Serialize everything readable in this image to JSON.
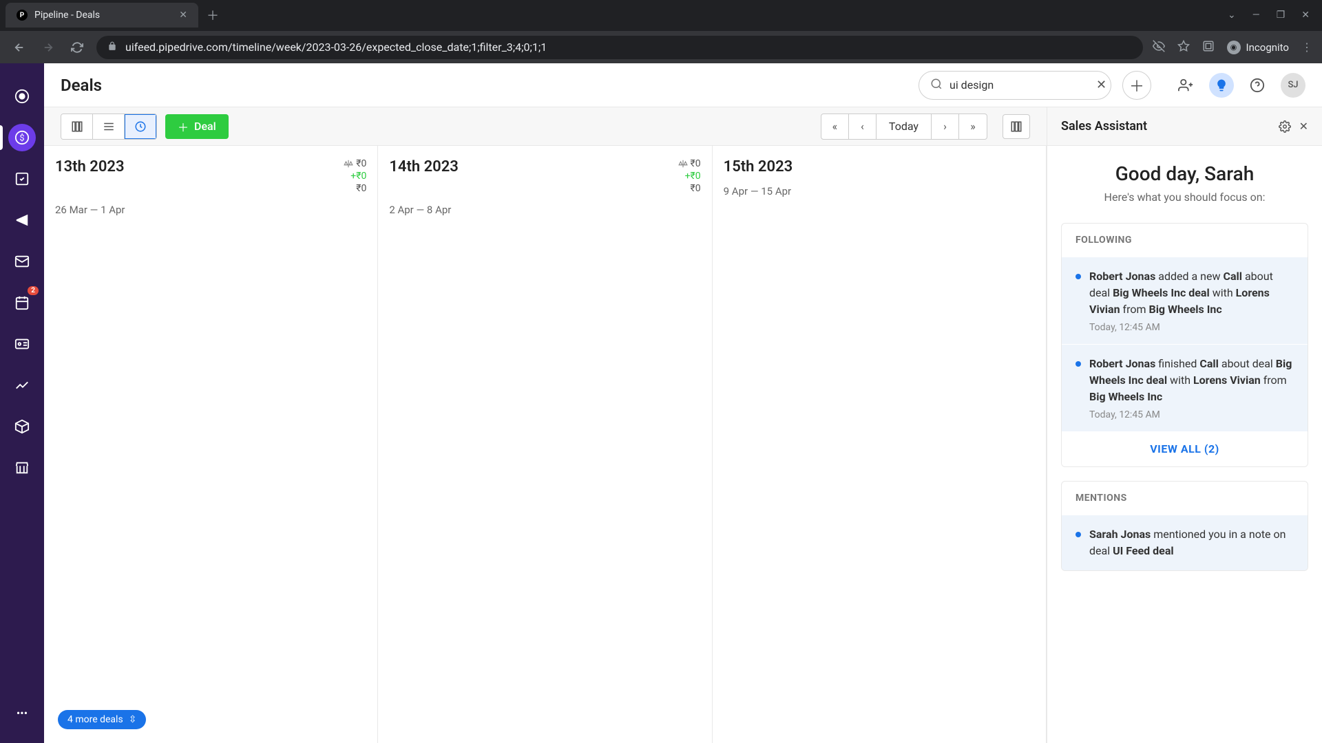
{
  "browser": {
    "tab_title": "Pipeline - Deals",
    "url": "uifeed.pipedrive.com/timeline/week/2023-03-26/expected_close_date;1;filter_3;4;0;1;1",
    "incognito_label": "Incognito"
  },
  "sidebar": {
    "badge_count": "2"
  },
  "header": {
    "title": "Deals",
    "search_value": "ui design",
    "avatar_initials": "SJ"
  },
  "toolbar": {
    "deal_label": "Deal",
    "today_label": "Today"
  },
  "timeline": {
    "weeks": [
      {
        "title": "13th 2023",
        "range": "26 Mar — 1 Apr",
        "weighted": "₹0",
        "delta": "+₹0",
        "total": "₹0"
      },
      {
        "title": "14th 2023",
        "range": "2 Apr — 8 Apr",
        "weighted": "₹0",
        "delta": "+₹0",
        "total": "₹0"
      },
      {
        "title": "15th 2023",
        "range": "9 Apr — 15 Apr",
        "weighted": "",
        "delta": "",
        "total": ""
      }
    ],
    "more_deals": "4 more deals"
  },
  "assistant": {
    "title": "Sales Assistant",
    "greeting": "Good day, Sarah",
    "subgreeting": "Here's what you should focus on:",
    "following_label": "FOLLOWING",
    "mentions_label": "MENTIONS",
    "view_all": "VIEW ALL (2)",
    "items": {
      "f1_actor": "Robert Jonas",
      "f1_verb": " added a new ",
      "f1_type": "Call",
      "f1_mid": " about deal ",
      "f1_deal": "Big Wheels Inc deal",
      "f1_with": " with ",
      "f1_person": "Lorens Vivian",
      "f1_from": " from ",
      "f1_org": "Big Wheels Inc",
      "f1_time": "Today, 12:45 AM",
      "f2_actor": "Robert Jonas",
      "f2_verb": " finished ",
      "f2_type": "Call",
      "f2_mid": " about deal ",
      "f2_deal": "Big Wheels Inc deal",
      "f2_with": " with ",
      "f2_person": "Lorens Vivian",
      "f2_from": " from ",
      "f2_org": "Big Wheels Inc",
      "f2_time": "Today, 12:45 AM",
      "m1_actor": "Sarah Jonas",
      "m1_verb": " mentioned you in a note on deal ",
      "m1_deal": "UI Feed deal"
    }
  }
}
